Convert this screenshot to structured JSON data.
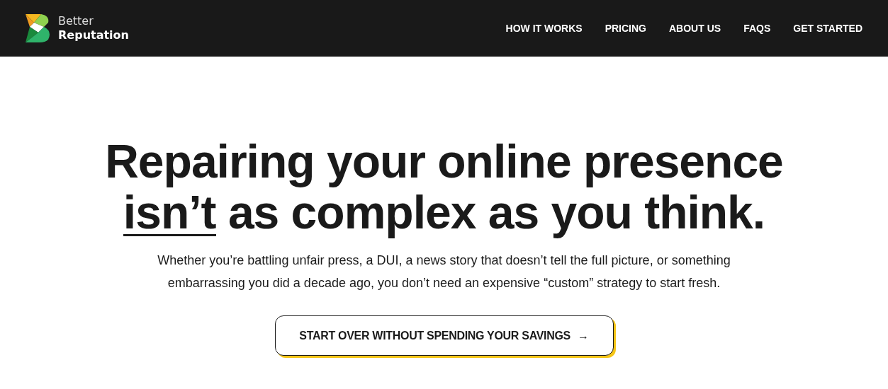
{
  "header": {
    "logo": {
      "line1": "Better",
      "line2": "Reputation"
    },
    "nav": [
      {
        "label": "HOW IT WORKS"
      },
      {
        "label": "PRICING"
      },
      {
        "label": "ABOUT US"
      },
      {
        "label": "FAQS"
      },
      {
        "label": "GET STARTED"
      }
    ]
  },
  "hero": {
    "headline": {
      "line1": "Repairing your online presence",
      "underlined": "isn’t",
      "rest": "as complex as you think."
    },
    "paragraph": "Whether you’re battling unfair press, a DUI, a news story that doesn’t tell the full picture, or something embarrassing you did a decade ago, you don’t need an expensive “custom” strategy to start fresh.",
    "button": {
      "label": "START OVER WITHOUT SPENDING YOUR SAVINGS",
      "icon": "→"
    }
  }
}
